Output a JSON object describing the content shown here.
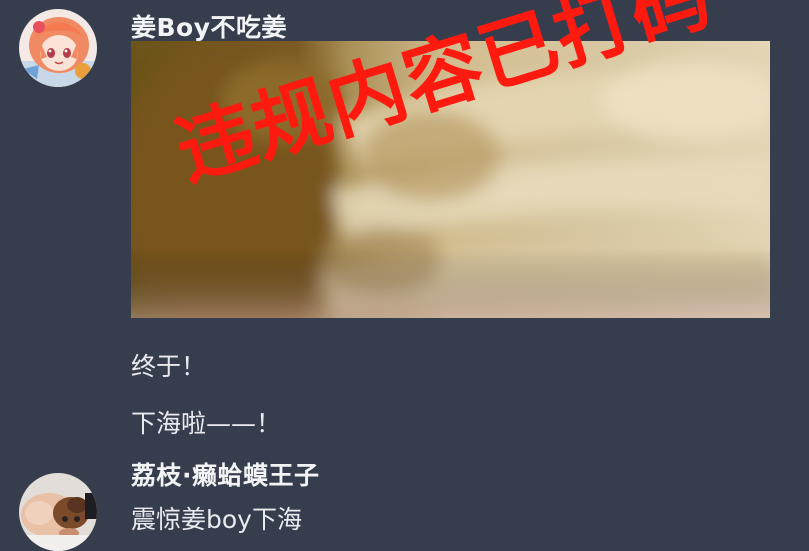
{
  "messages": [
    {
      "author": "姜Boy不吃姜",
      "avatar_icon": "anime-girl-avatar-icon",
      "image": {
        "stamp_text": "违规内容已打码",
        "stamp_color": "#ff1a10"
      },
      "texts": [
        "终于！",
        "下海啦——！"
      ]
    },
    {
      "author": "荔枝·癞蛤蟆王子",
      "avatar_icon": "photo-avatar-icon",
      "texts": [
        "震惊姜boy下海"
      ]
    }
  ],
  "colors": {
    "background": "#363d4d",
    "username": "#f2f3f5",
    "text": "#eaebef"
  }
}
